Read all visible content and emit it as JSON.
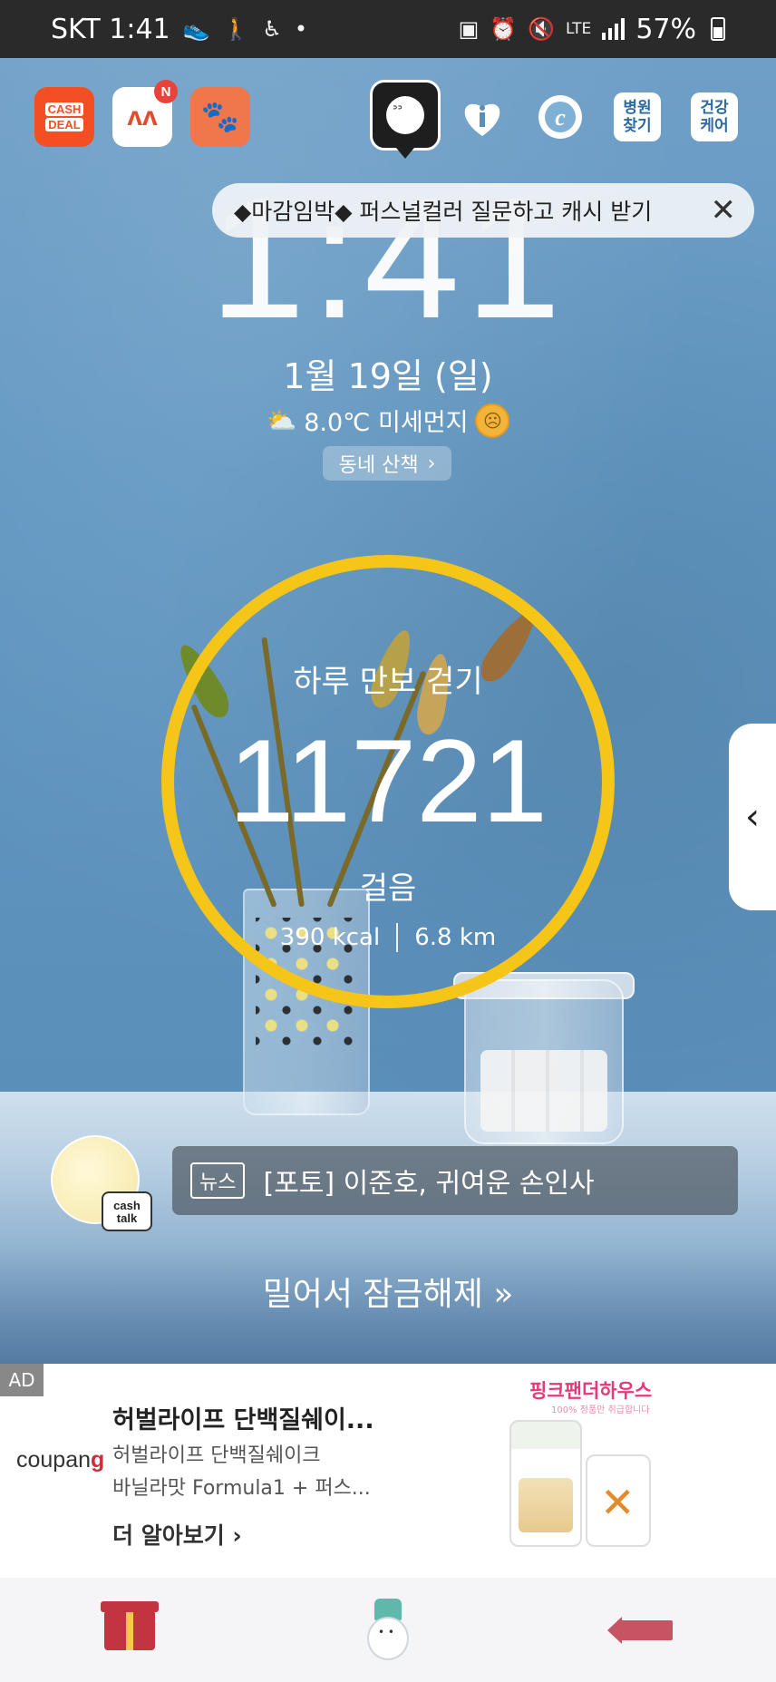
{
  "status_bar": {
    "carrier_time": "SKT 1:41",
    "network": "LTE",
    "battery": "57%"
  },
  "top_apps": {
    "cashdeal_line1": "CASH",
    "cashdeal_line2": "DEAL",
    "app2_badge": "N",
    "hospital_label": "병원\n찾기",
    "hospital_line1": "병원",
    "hospital_line2": "찾기",
    "health_line1": "건강",
    "health_line2": "케어"
  },
  "banner": {
    "text": "◆마감임박◆ 퍼스널컬러 질문하고 캐시 받기",
    "close": "✕"
  },
  "lockscreen": {
    "time": "1:41",
    "date": "1월 19일 (일)",
    "weather_text": "8.0℃ 미세먼지",
    "walk_chip": "동네 산책",
    "walk_chevron": "›"
  },
  "steps": {
    "title": "하루 만보 걷기",
    "count": "11721",
    "unit": "걸음",
    "kcal": "390 kcal",
    "distance": "6.8 km"
  },
  "side_handle": {
    "chevron": "‹"
  },
  "cashtalk": {
    "line1": "cash",
    "line2": "talk"
  },
  "news": {
    "tag": "뉴스",
    "headline": "[포토] 이준호, 귀여운 손인사"
  },
  "unlock": {
    "text": "밀어서 잠금해제 »"
  },
  "ad": {
    "label": "AD",
    "brand_part1": "coupan",
    "brand_part2": "g",
    "title": "허벌라이프 단백질쉐이...",
    "desc_line1": "허벌라이프 단백질쉐이크",
    "desc_line2": "바닐라맛 Formula1 + 퍼스...",
    "more": "더 알아보기 ›",
    "shop_name": "핑크팬더하우스",
    "shop_sub": "100% 정품만 취급합니다"
  },
  "colors": {
    "ring": "#f5c518",
    "accent_red": "#c2343f",
    "banner_bg": "#eef2f6"
  }
}
